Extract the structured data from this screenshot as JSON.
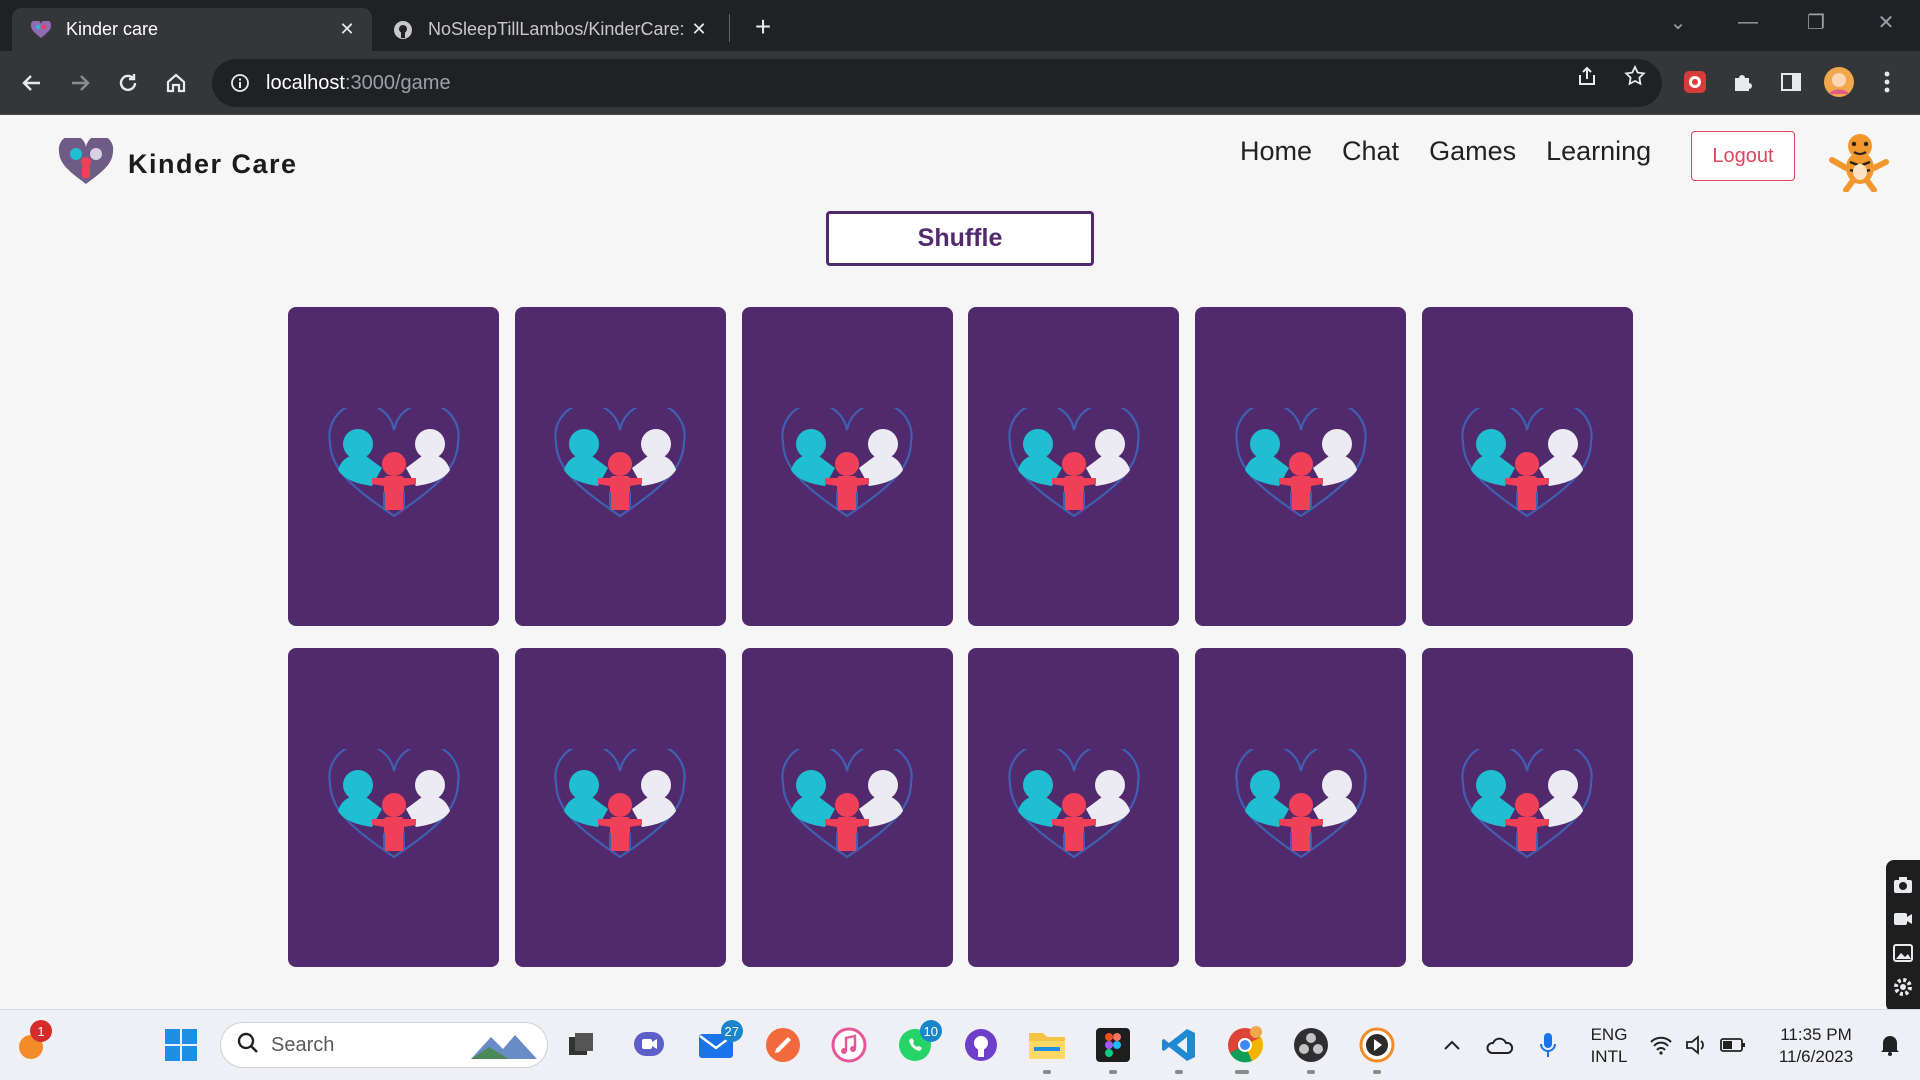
{
  "browser": {
    "tabs": [
      {
        "title": "Kinder care",
        "active": true
      },
      {
        "title": "NoSleepTillLambos/KinderCare:",
        "active": false
      }
    ],
    "url": {
      "host": "localhost",
      "rest": ":3000/game"
    }
  },
  "app": {
    "brand": "Kinder Care",
    "nav": [
      "Home",
      "Chat",
      "Games",
      "Learning"
    ],
    "logout_label": "Logout",
    "shuffle_label": "Shuffle",
    "card_count": 12,
    "card_color": "#512a6d"
  },
  "taskbar": {
    "search_placeholder": "Search",
    "badges": {
      "mail": "27",
      "whatsapp": "10",
      "notifications": "1"
    },
    "lang_line1": "ENG",
    "lang_line2": "INTL",
    "time": "11:35 PM",
    "date": "11/6/2023"
  },
  "colors": {
    "accent_purple": "#512a6d",
    "logout_red": "#e0455f",
    "logo_teal": "#1fbfd1",
    "logo_red": "#ef4058"
  }
}
